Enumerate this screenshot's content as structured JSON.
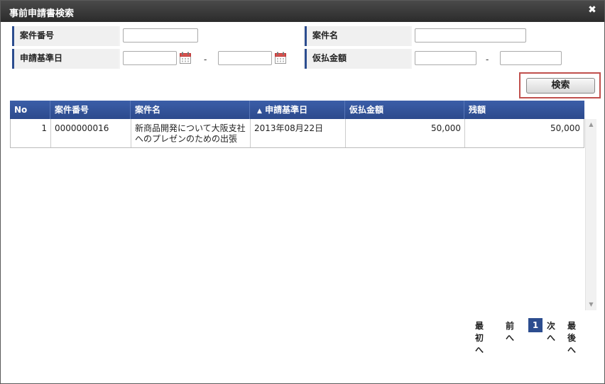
{
  "dialog": {
    "title": "事前申請書検索",
    "close_glyph": "✖"
  },
  "form": {
    "case_number_label": "案件番号",
    "case_name_label": "案件名",
    "apply_date_label": "申請基準日",
    "advance_amount_label": "仮払金額",
    "range_separator": "-",
    "case_number_value": "",
    "case_name_value": "",
    "apply_date_from": "",
    "apply_date_to": "",
    "amount_from": "",
    "amount_to": ""
  },
  "search": {
    "label": "検索"
  },
  "grid": {
    "columns": {
      "no": "No",
      "case_number": "案件番号",
      "case_name": "案件名",
      "apply_date": "申請基準日",
      "advance_amount": "仮払金額",
      "balance": "残額"
    },
    "sort_indicator": "▲",
    "rows": [
      {
        "no": "1",
        "case_number": "0000000016",
        "case_name": "新商品開発について大阪支社へのプレゼンのための出張",
        "apply_date": "2013年08月22日",
        "advance_amount": "50,000",
        "balance": "50,000"
      }
    ]
  },
  "pager": {
    "first": "最初へ",
    "prev": "前へ",
    "current": "1",
    "next": "次へ",
    "last": "最後へ"
  },
  "colors": {
    "accent": "#2c4d8f",
    "highlight_border": "#c0504d"
  }
}
